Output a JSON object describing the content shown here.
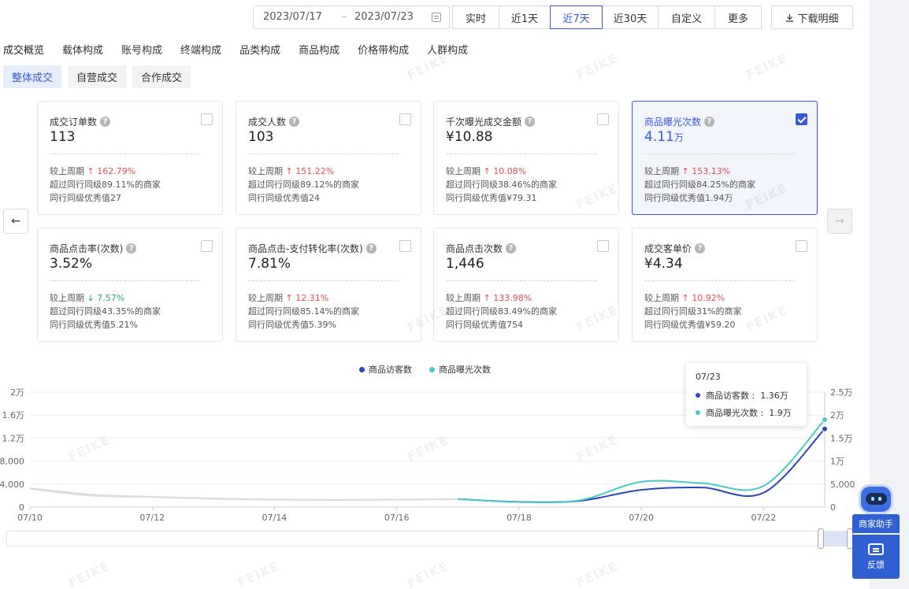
{
  "toolbar": {
    "date_start": "2023/07/17",
    "date_sep": "–",
    "date_end": "2023/07/23",
    "ranges": [
      "实时",
      "近1天",
      "近7天",
      "近30天",
      "自定义",
      "更多"
    ],
    "active_range": "近7天",
    "download_label": "下载明细"
  },
  "tabs": [
    "成交概览",
    "载体构成",
    "账号构成",
    "终端构成",
    "品类构成",
    "商品构成",
    "价格带构成",
    "人群构成"
  ],
  "subtabs": [
    "整体成交",
    "自营成交",
    "合作成交"
  ],
  "cards": [
    {
      "title": "成交订单数",
      "value": "113",
      "unit": "",
      "cmp_label": "较上周期",
      "trend": "up",
      "change": "162.79%",
      "line2": "超过同行同级89.11%的商家",
      "line3": "同行同级优秀值27",
      "checked": false
    },
    {
      "title": "成交人数",
      "value": "103",
      "unit": "",
      "cmp_label": "较上周期",
      "trend": "up",
      "change": "151.22%",
      "line2": "超过同行同级89.12%的商家",
      "line3": "同行同级优秀值24",
      "checked": false
    },
    {
      "title": "千次曝光成交金额",
      "value": "¥10.88",
      "unit": "",
      "cmp_label": "较上周期",
      "trend": "up",
      "change": "10.08%",
      "line2": "超过同行同级38.46%的商家",
      "line3": "同行同级优秀值¥79.31",
      "checked": false
    },
    {
      "title": "商品曝光次数",
      "value": "4.11",
      "unit": "万",
      "cmp_label": "较上周期",
      "trend": "up",
      "change": "153.13%",
      "line2": "超过同行同级84.25%的商家",
      "line3": "同行同级优秀值1.94万",
      "checked": true
    },
    {
      "title": "商品点击率(次数)",
      "value": "3.52%",
      "unit": "",
      "cmp_label": "较上周期",
      "trend": "down",
      "change": "7.57%",
      "line2": "超过同行同级43.35%的商家",
      "line3": "同行同级优秀值5.21%",
      "checked": false
    },
    {
      "title": "商品点击-支付转化率(次数)",
      "value": "7.81%",
      "unit": "",
      "cmp_label": "较上周期",
      "trend": "up",
      "change": "12.31%",
      "line2": "超过同行同级85.14%的商家",
      "line3": "同行同级优秀值5.39%",
      "checked": false
    },
    {
      "title": "商品点击次数",
      "value": "1,446",
      "unit": "",
      "cmp_label": "较上周期",
      "trend": "up",
      "change": "133.98%",
      "line2": "超过同行同级83.49%的商家",
      "line3": "同行同级优秀值754",
      "checked": false
    },
    {
      "title": "成交客单价",
      "value": "¥4.34",
      "unit": "",
      "cmp_label": "较上周期",
      "trend": "up",
      "change": "10.92%",
      "line2": "超过同行同级31%的商家",
      "line3": "同行同级优秀值¥59.20",
      "checked": false
    }
  ],
  "colors": {
    "accent": "#3858d6",
    "visitors": "#2b46b8",
    "exposure": "#4cc9c6",
    "prev": "#d9dce1",
    "up": "#e84d4d",
    "down": "#2aa676"
  },
  "tooltip": {
    "date": "07/23",
    "rows": [
      {
        "label": "商品访客数 :",
        "value": "1.36万"
      },
      {
        "label": "商品曝光次数 :",
        "value": "1.9万"
      }
    ]
  },
  "helper": {
    "label": "商家助手",
    "feedback": "反馈"
  },
  "watermark": "FEIKE",
  "chart_data": {
    "type": "line",
    "x": [
      "07/10",
      "07/11",
      "07/12",
      "07/13",
      "07/14",
      "07/15",
      "07/16",
      "07/17",
      "07/18",
      "07/19",
      "07/20",
      "07/21",
      "07/22",
      "07/23"
    ],
    "x_ticks": [
      "07/10",
      "07/12",
      "07/14",
      "07/16",
      "07/18",
      "07/20",
      "07/22"
    ],
    "left_axis": {
      "ticks": [
        "0",
        "4,000",
        "8,000",
        "1.2万",
        "1.6万",
        "2万"
      ],
      "min": 0,
      "max": 20000
    },
    "right_axis": {
      "ticks": [
        "0",
        "5,000",
        "1万",
        "1.5万",
        "2万",
        "2.5万"
      ],
      "min": 0,
      "max": 25000
    },
    "series": [
      {
        "name": "商品访客数",
        "axis": "left",
        "values": [
          3300,
          2200,
          1800,
          1500,
          1300,
          1250,
          1300,
          1400,
          900,
          1100,
          3000,
          3400,
          2500,
          13600
        ],
        "prev_period_until": "07/17"
      },
      {
        "name": "商品曝光次数",
        "axis": "right",
        "values": [
          4000,
          2500,
          2200,
          1800,
          1600,
          1550,
          1600,
          1750,
          1100,
          1500,
          5500,
          5200,
          4600,
          19000
        ],
        "prev_period_until": "07/17"
      }
    ],
    "legend_position": "top-center",
    "grid": true
  }
}
